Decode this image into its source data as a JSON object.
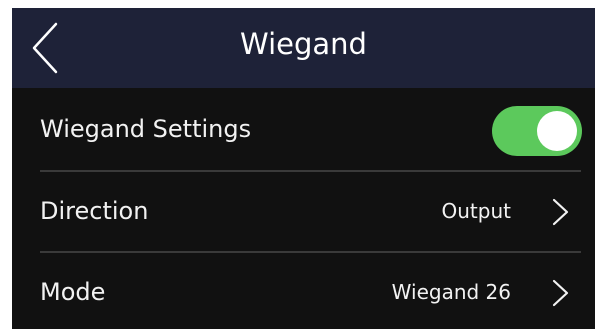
{
  "header": {
    "title": "Wiegand",
    "back_icon": "chevron-left-icon"
  },
  "settings": {
    "wiegand_settings": {
      "label": "Wiegand Settings",
      "enabled": true,
      "toggle_color": "#5cc95c"
    },
    "direction": {
      "label": "Direction",
      "value": "Output",
      "icon": "chevron-right-icon"
    },
    "mode": {
      "label": "Mode",
      "value": "Wiegand 26",
      "icon": "chevron-right-icon"
    }
  },
  "colors": {
    "header_bg": "#1e2238",
    "body_bg": "#111111",
    "text": "#f2f2f2",
    "divider": "#3a3a3a"
  }
}
